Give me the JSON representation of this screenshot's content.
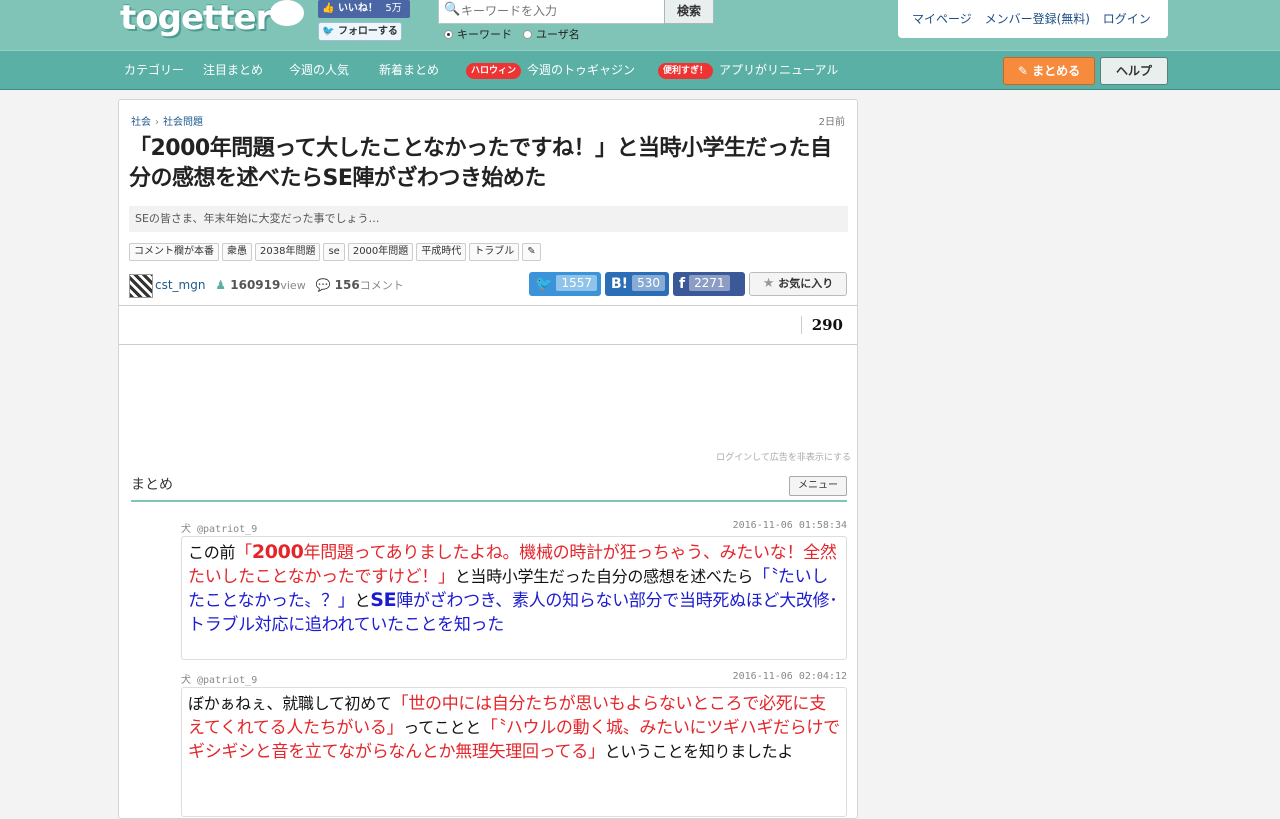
{
  "header": {
    "logo": "togetter",
    "fb_like_label": "いいね！",
    "fb_like_count": "5万",
    "tw_follow_label": "フォローする",
    "search_placeholder": "キーワードを入力",
    "search_button": "検索",
    "radio_keyword": "キーワード",
    "radio_user": "ユーザ名",
    "user_links": [
      "マイページ",
      "メンバー登録(無料)",
      "ログイン"
    ]
  },
  "nav": {
    "items": [
      "カテゴリー",
      "注目まとめ",
      "今週の人気",
      "新着まとめ"
    ],
    "promo1_pill": "ハロウィン",
    "promo1_text": "今週のトゥギャジン",
    "promo2_pill": "便利すぎ！",
    "promo2_text": "アプリがリニューアル",
    "matome_button": "まとめる",
    "help_button": "ヘルプ"
  },
  "article": {
    "breadcrumb": [
      "社会",
      "社会問題"
    ],
    "ago": "2日前",
    "title": "「2000年問題って大したことなかったですね！」と当時小学生だった自分の感想を述べたらSE陣がざわつき始めた",
    "description": "SEの皆さま、年末年始に大変だった事でしょう…",
    "tags": [
      "コメント欄が本番",
      "衆愚",
      "2038年問題",
      "se",
      "2000年問題",
      "平成時代",
      "トラブル"
    ],
    "author": "cst_mgn",
    "views": "160919",
    "views_unit": "view",
    "comments": "156",
    "comments_unit": "コメント",
    "share_twitter": "1557",
    "share_hatena": "530",
    "share_facebook": "2271",
    "favorite_label": "お気に入り",
    "count": "290",
    "ad_note": "ログインして広告を非表示にする",
    "section_label": "まとめ",
    "menu_button": "メニュー"
  },
  "tweets": [
    {
      "user": "犬 @patriot_9",
      "time": "2016-11-06 01:58:34",
      "p1": "この前",
      "p2": "「",
      "p3": "2000",
      "p4": "年問題ってありましたよね。機械の時計が狂っちゃう、みたいな！全然たいしたことなかったですけど！」",
      "p5": "と当時小学生だった自分の感想を述べたら",
      "p6": "「〝たいしたことなかった〟？」",
      "p7": "と",
      "p8": "SE",
      "p9": "陣がざわつき、素人の知らない部分で当時死ぬほど大改修･トラブル対応に追われていたことを知った"
    },
    {
      "user": "犬 @patriot_9",
      "time": "2016-11-06 02:04:12",
      "p1": "ぼかぁねぇ、就職して初めて",
      "p2": "「世の中には自分たちが思いもよらないところで必死に支えてくれてる人たちがいる」",
      "p3": "ってことと",
      "p4": "「〝ハウルの動く城〟みたいにツギハギだらけでギシギシと音を立てながらなんとか無理矢理回ってる」",
      "p5": "ということを知りましたよ"
    }
  ]
}
